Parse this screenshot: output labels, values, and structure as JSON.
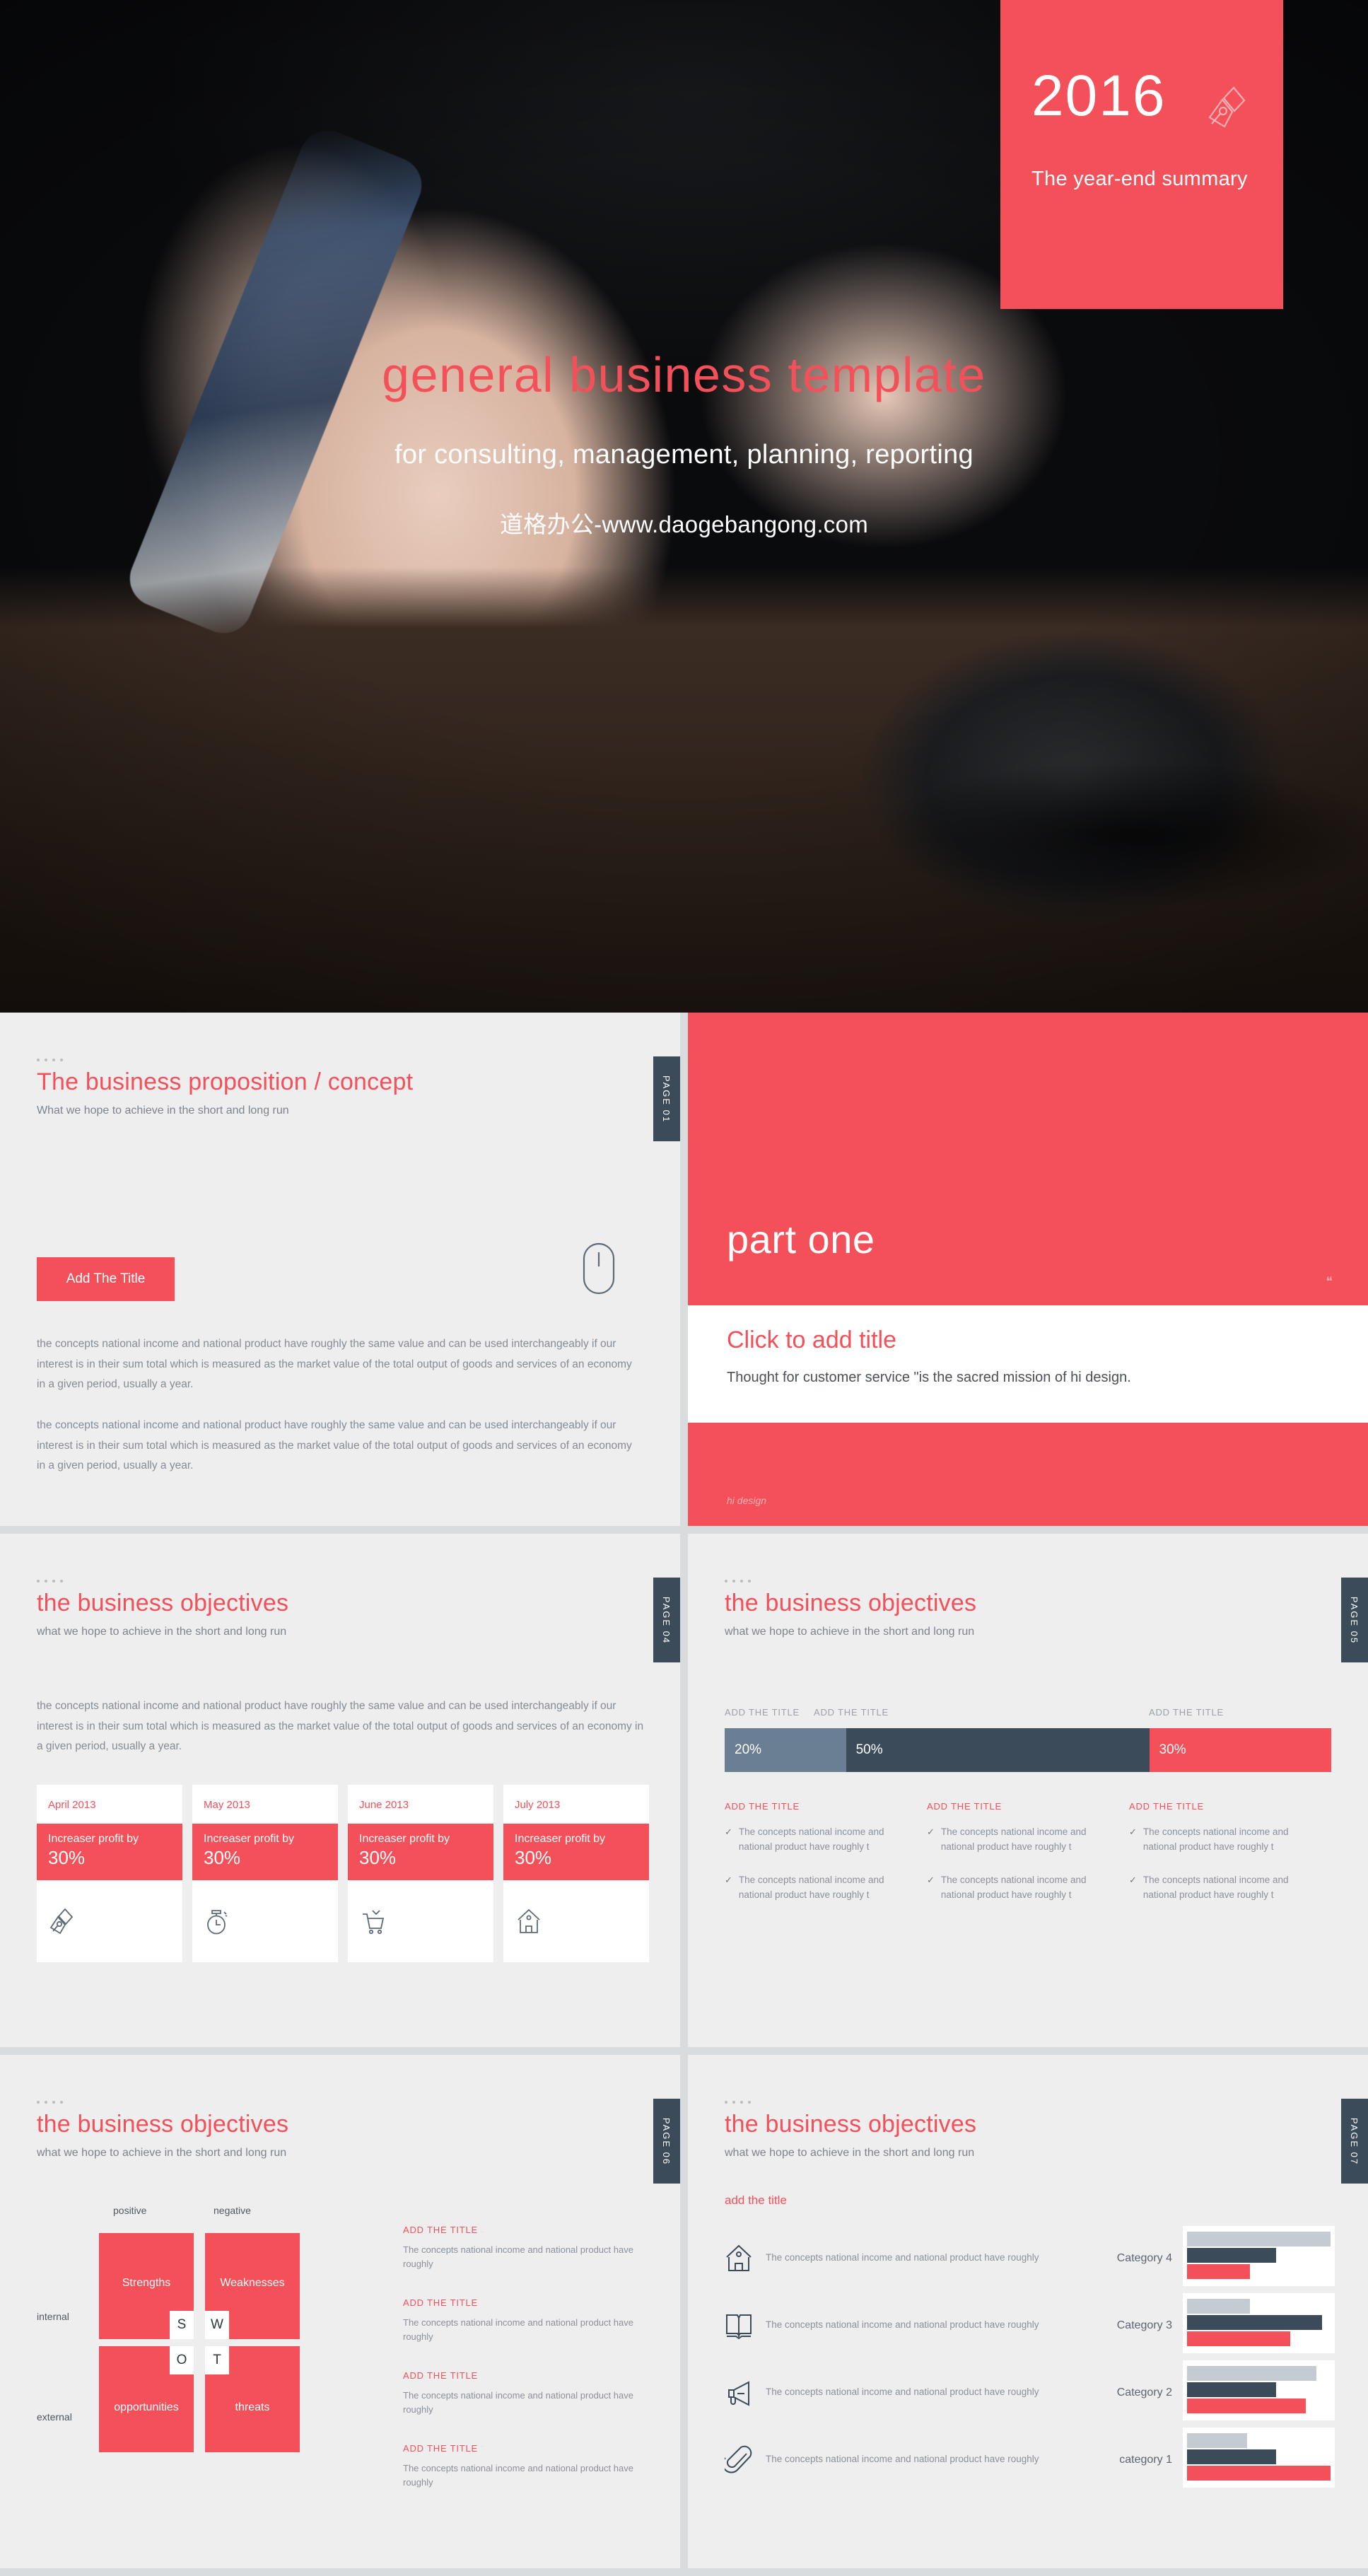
{
  "accent_color": "#f4505a",
  "dark_color": "#3b4b59",
  "slate_color": "#6a7f93",
  "light_gray_color": "#c4cbd2",
  "hero": {
    "year": "2016",
    "year_subtitle": "The year-end summary",
    "nib_icon": "pen-nib-icon",
    "title": "general business template",
    "subtitle": "for consulting, management, planning, reporting",
    "url": "道格办公-www.daogebangong.com"
  },
  "slides": [
    {
      "page_tab": "PAGE 01",
      "title": "The business proposition / concept",
      "subtitle": "What we hope to achieve in the short and long run",
      "button_label": "Add The Title",
      "mouse_icon": "mouse-icon",
      "paragraph_1": "the concepts national income and national product have roughly the same value and can be used interchangeably if our interest is in their sum total which is measured as the market value of the total output of goods and services of an economy in a given period, usually a year.",
      "paragraph_2": "the concepts national income and national product have roughly the same value and can be used interchangeably if our interest is in their sum total which is measured as the market value of the total output of goods and services of an economy in a given period, usually a year."
    },
    {
      "part_title": "part one",
      "quote_mark": "❝",
      "click_title": "Click to add title",
      "thought": "Thought for customer service \"is the sacred mission of hi design.",
      "footer": "hi design"
    },
    {
      "page_tab": "PAGE 04",
      "title": "the business objectives",
      "subtitle": "what we hope to achieve in the short and long run",
      "paragraph": "the concepts national income and national product have roughly the same value and can be used interchangeably if our interest is in their sum total which is measured as the market value of the total output of goods and services of an economy in a given period, usually a year.",
      "cards": [
        {
          "date": "April 2013",
          "label": "Increaser profit by",
          "percent": "30%",
          "icon": "pen-nib-icon"
        },
        {
          "date": "May 2013",
          "label": "Increaser profit by",
          "percent": "30%",
          "icon": "stopwatch-icon"
        },
        {
          "date": "June 2013",
          "label": "Increaser profit by",
          "percent": "30%",
          "icon": "shopping-cart-icon"
        },
        {
          "date": "July 2013",
          "label": "Increaser profit by",
          "percent": "30%",
          "icon": "home-icon"
        }
      ]
    },
    {
      "page_tab": "PAGE 05",
      "title": "the business objectives",
      "subtitle": "what we hope to achieve in the short and long run",
      "bar_headers": [
        "ADD THE TITLE",
        "ADD THE TITLE",
        "ADD THE TITLE"
      ],
      "column_headers": [
        "ADD THE TITLE",
        "ADD THE TITLE",
        "ADD THE TITLE"
      ],
      "bullet_check": "✓",
      "bullet_text": "The concepts national income and national product have roughly t"
    },
    {
      "page_tab": "PAGE 06",
      "title": "the business objectives",
      "subtitle": "what we hope to achieve in the short and long run",
      "axis_top": [
        "positive",
        "negative"
      ],
      "axis_left": [
        "internal",
        "external"
      ],
      "quadrants": [
        {
          "letter": "S",
          "label": "Strengths"
        },
        {
          "letter": "W",
          "label": "Weaknesses"
        },
        {
          "letter": "O",
          "label": "opportunities"
        },
        {
          "letter": "T",
          "label": "threats"
        }
      ],
      "list": [
        {
          "heading": "ADD THE TITLE",
          "body": "The concepts national income and national product have roughly"
        },
        {
          "heading": "ADD THE TITLE",
          "body": "The concepts national income and national product have roughly"
        },
        {
          "heading": "ADD THE TITLE",
          "body": "The concepts national income and national product have roughly"
        },
        {
          "heading": "ADD THE TITLE",
          "body": "The concepts national income and national product have roughly"
        }
      ]
    },
    {
      "page_tab": "PAGE 07",
      "title": "the business objectives",
      "subtitle": "what we hope to achieve in the short and long run",
      "add_title": "add the title",
      "rows": [
        {
          "icon": "home-icon",
          "text": "The concepts national income and national product have roughly",
          "category": "Category 4"
        },
        {
          "icon": "open-book-icon",
          "text": "The concepts national income and national product have roughly",
          "category": "Category 3"
        },
        {
          "icon": "megaphone-icon",
          "text": "The concepts national income and national product have roughly",
          "category": "Category 2"
        },
        {
          "icon": "paperclip-icon",
          "text": "The concepts national income and national product have roughly",
          "category": "category 1"
        }
      ]
    }
  ],
  "chart_data": [
    {
      "type": "bar",
      "title": "",
      "orientation": "horizontal",
      "categories": [
        "20%",
        "50%",
        "30%"
      ],
      "values": [
        20,
        50,
        30
      ],
      "labels": [
        "ADD THE TITLE",
        "ADD THE TITLE",
        "ADD THE TITLE"
      ],
      "colors": [
        "#6a7f93",
        "#3b4b59",
        "#f4505a"
      ],
      "stacked": true,
      "xlabel": "",
      "ylabel": "",
      "xlim": [
        0,
        100
      ],
      "grid": false,
      "legend": "none"
    },
    {
      "type": "bar",
      "orientation": "horizontal",
      "title": "",
      "categories": [
        "Category 4",
        "Category 3",
        "Category 2",
        "category 1"
      ],
      "series": [
        {
          "name": "series-light-gray",
          "color": "#c4cbd2",
          "values": [
            100,
            44,
            90,
            42
          ]
        },
        {
          "name": "series-dark-slate",
          "color": "#3b4b59",
          "values": [
            62,
            94,
            62,
            62
          ]
        },
        {
          "name": "series-red",
          "color": "#f4505a",
          "values": [
            44,
            72,
            83,
            100
          ]
        }
      ],
      "xlabel": "",
      "ylabel": "",
      "xlim": [
        0,
        100
      ],
      "grid": false,
      "legend": "none"
    }
  ]
}
